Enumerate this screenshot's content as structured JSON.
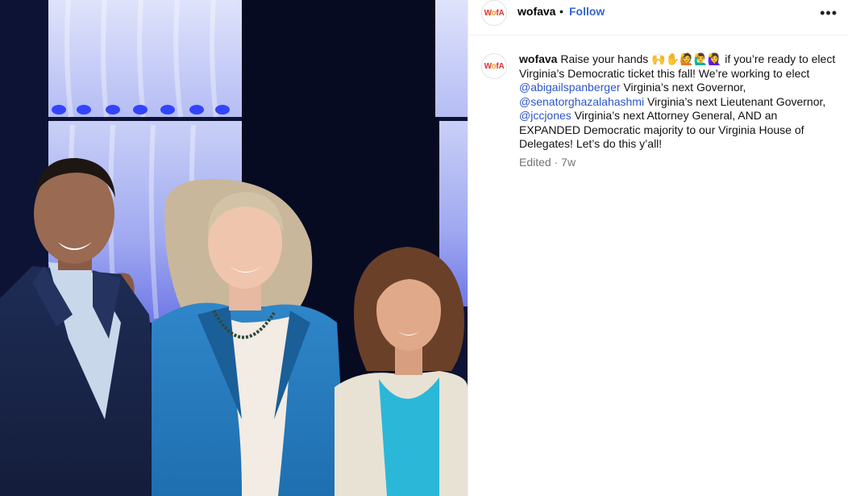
{
  "post": {
    "account": {
      "username": "wofava",
      "avatar_text": "WofA",
      "follow_label": "Follow",
      "separator": "•",
      "more_icon": "more-horizontal-icon"
    },
    "caption": {
      "username": "wofava",
      "part1": "Raise your hands 🙌✋🙋🙋‍♂️🙋‍♀️ if you’re ready to elect Virginia’s Democratic ticket this fall! We’re working to elect ",
      "mention1": "@abigailspanberger",
      "part2": " Virginia’s next Governor, ",
      "mention2": "@senatorghazalahashmi",
      "part3": " Virginia’s next Lieutenant Governor, ",
      "mention3": "@jccjones",
      "part4": " Virginia’s next Attorney General, AND an EXPANDED Democratic majority to our Virginia House of Delegates! Let’s do this y’all!"
    },
    "meta": {
      "edited": "Edited",
      "separator": "·",
      "age": "7w"
    }
  },
  "colors": {
    "follow": "#3565d6",
    "mention": "#2b55c8",
    "muted": "#737373",
    "stage_blue": "#5b6df0"
  }
}
